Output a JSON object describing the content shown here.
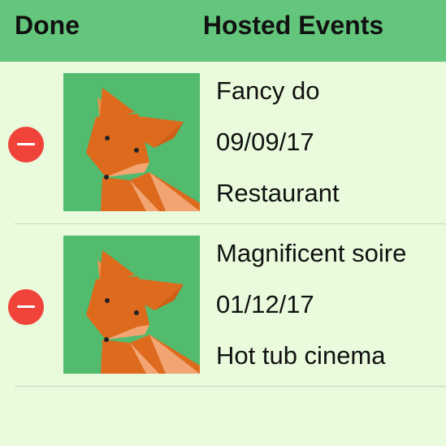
{
  "navbar": {
    "done_label": "Done",
    "title": "Hosted Events",
    "background": "#64c67c"
  },
  "events": [
    {
      "name": "Fancy do",
      "date": "09/09/17",
      "venue": "Restaurant",
      "image_icon": "fox-icon"
    },
    {
      "name": "Magnificent soire",
      "date": "01/12/17",
      "venue": "Hot tub cinema",
      "image_icon": "fox-icon"
    }
  ],
  "colors": {
    "list_background": "#e9fbdc",
    "delete_red": "#f0433a",
    "thumb_green": "#52bb6e",
    "fox_orange": "#de6a1e",
    "fox_light": "#f2a572"
  }
}
